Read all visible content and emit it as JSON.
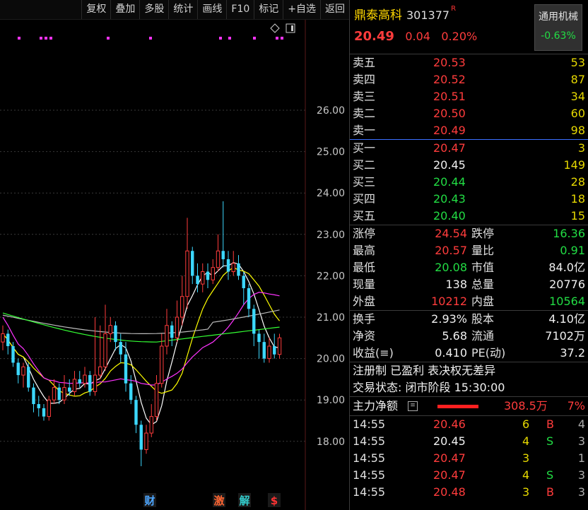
{
  "toolbar": {
    "buttons": [
      "复权",
      "叠加",
      "多股",
      "统计",
      "画线",
      "F10",
      "标记",
      "+自选",
      "返回"
    ]
  },
  "chart": {
    "y_labels": [
      "26.00",
      "25.00",
      "24.00",
      "23.00",
      "22.00",
      "21.00",
      "20.00",
      "19.00",
      "18.00"
    ],
    "event_markers": [
      {
        "label": "财",
        "color": "#4da6ff"
      },
      {
        "label": "激",
        "color": "#ff6633"
      },
      {
        "label": "解",
        "color": "#33cccc"
      },
      {
        "label": "$",
        "color": "#ff3333"
      }
    ],
    "colors": {
      "up": "#ff3c3c",
      "down": "#3cd8ff",
      "ma5": "#ffffff",
      "ma10": "#ffff00",
      "ma20": "#ff33ff",
      "ma60": "#33ff33",
      "ma_long": "#bbbbbb"
    }
  },
  "quote": {
    "name": "鼎泰高科",
    "code": "301377",
    "r_mark": "R",
    "price": "20.49",
    "change": "0.04",
    "change_pct": "0.20%",
    "sector_name": "通用机械",
    "sector_change": "-0.63%"
  },
  "order_book": {
    "sell": [
      {
        "label": "卖五",
        "price": "20.53",
        "vol": "53"
      },
      {
        "label": "卖四",
        "price": "20.52",
        "vol": "87"
      },
      {
        "label": "卖三",
        "price": "20.51",
        "vol": "34"
      },
      {
        "label": "卖二",
        "price": "20.50",
        "vol": "60"
      },
      {
        "label": "卖一",
        "price": "20.49",
        "vol": "98"
      }
    ],
    "buy": [
      {
        "label": "买一",
        "price": "20.47",
        "vol": "3",
        "color": "red"
      },
      {
        "label": "买二",
        "price": "20.45",
        "vol": "149",
        "color": "white"
      },
      {
        "label": "买三",
        "price": "20.44",
        "vol": "28",
        "color": "green"
      },
      {
        "label": "买四",
        "price": "20.43",
        "vol": "18",
        "color": "green"
      },
      {
        "label": "买五",
        "price": "20.40",
        "vol": "15",
        "color": "green"
      }
    ]
  },
  "stats": [
    {
      "l1": "涨停",
      "v1": "24.54",
      "c1": "red",
      "l2": "跌停",
      "v2": "16.36",
      "c2": "green"
    },
    {
      "l1": "最高",
      "v1": "20.57",
      "c1": "red",
      "l2": "量比",
      "v2": "0.91",
      "c2": "green"
    },
    {
      "l1": "最低",
      "v1": "20.08",
      "c1": "green",
      "l2": "市值",
      "v2": "84.0亿",
      "c2": "white"
    },
    {
      "l1": "现量",
      "v1": "138",
      "c1": "white",
      "l2": "总量",
      "v2": "20776",
      "c2": "white"
    },
    {
      "l1": "外盘",
      "v1": "10212",
      "c1": "red",
      "l2": "内盘",
      "v2": "10564",
      "c2": "green"
    }
  ],
  "stats2": [
    {
      "l1": "换手",
      "v1": "2.93%",
      "c1": "white",
      "l2": "股本",
      "v2": "4.10亿",
      "c2": "white"
    },
    {
      "l1": "净资",
      "v1": "5.68",
      "c1": "white",
      "l2": "流通",
      "v2": "7102万",
      "c2": "white"
    },
    {
      "l1": "收益(≡)",
      "v1": "0.410",
      "c1": "white",
      "l2": "PE(动)",
      "v2": "37.2",
      "c2": "white"
    }
  ],
  "info": {
    "line1": "注册制 已盈利 表决权无差异",
    "line2": "交易状态: 闭市阶段 15:30:00"
  },
  "flow": {
    "label": "主力净额",
    "amount": "308.5万",
    "pct": "7%"
  },
  "ticks": [
    {
      "time": "14:55",
      "price": "20.46",
      "pcolor": "red",
      "vol": "6",
      "bs": "B",
      "bscolor": "red",
      "n": "4"
    },
    {
      "time": "14:55",
      "price": "20.45",
      "pcolor": "white",
      "vol": "4",
      "bs": "S",
      "bscolor": "green",
      "n": "3"
    },
    {
      "time": "14:55",
      "price": "20.47",
      "pcolor": "red",
      "vol": "3",
      "bs": "",
      "bscolor": "white",
      "n": "1"
    },
    {
      "time": "14:55",
      "price": "20.47",
      "pcolor": "red",
      "vol": "4",
      "bs": "S",
      "bscolor": "green",
      "n": "3"
    },
    {
      "time": "14:55",
      "price": "20.48",
      "pcolor": "red",
      "vol": "3",
      "bs": "B",
      "bscolor": "red",
      "n": "3"
    }
  ]
}
